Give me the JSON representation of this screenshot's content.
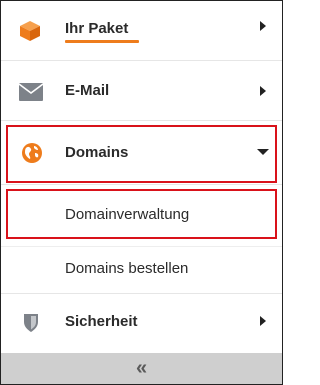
{
  "menu": {
    "items": [
      {
        "label": "Ihr Paket",
        "icon": "package-icon",
        "expanded": false,
        "active": true
      },
      {
        "label": "E-Mail",
        "icon": "envelope-icon",
        "expanded": false
      },
      {
        "label": "Domains",
        "icon": "globe-icon",
        "expanded": true,
        "children": [
          {
            "label": "Domainverwaltung"
          },
          {
            "label": "Domains bestellen"
          }
        ]
      },
      {
        "label": "Sicherheit",
        "icon": "shield-icon",
        "expanded": false
      }
    ],
    "collapse_label": "«"
  },
  "colors": {
    "accent": "#ee7c1c",
    "highlight": "#d9121a",
    "icon_gray": "#7d8289",
    "footer": "#cfcfcf"
  }
}
